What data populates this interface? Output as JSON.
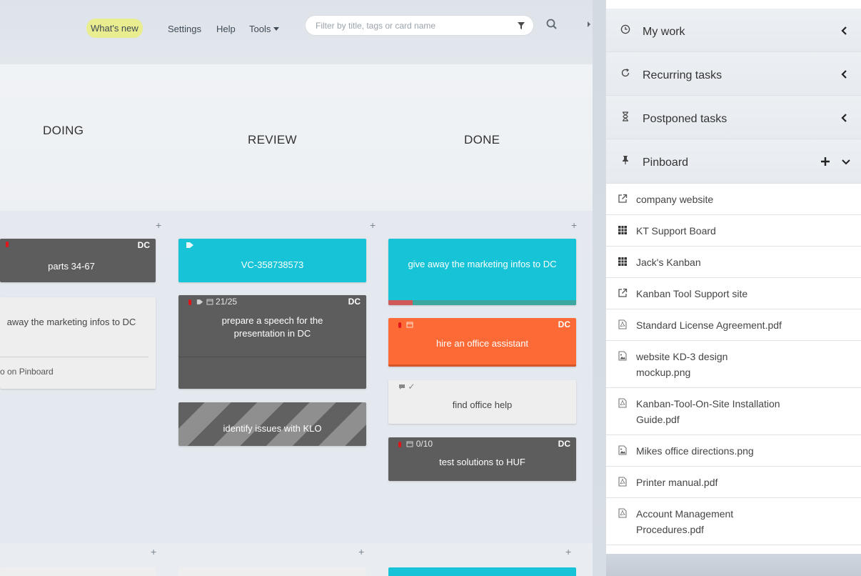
{
  "topbar": {
    "whats_new": "What's new",
    "settings": "Settings",
    "help": "Help",
    "tools": "Tools",
    "filter_placeholder": "Filter by title, tags or card name"
  },
  "columns": {
    "doing": "DOING",
    "review": "REVIEW",
    "done": "DONE"
  },
  "cards": {
    "doing_1": {
      "title": "parts 34-67",
      "owner": "DC"
    },
    "doing_2": {
      "title": "away the marketing infos to DC",
      "footer": "o on Pinboard"
    },
    "review_1": {
      "title": "VC-358738573"
    },
    "review_2": {
      "title": "prepare a speech for the presentation in DC",
      "progress": "21/25",
      "owner": "DC"
    },
    "review_3": {
      "title": "identify issues with KLO"
    },
    "done_1": {
      "title": "give away the marketing infos to DC"
    },
    "done_2": {
      "title": "hire an office assistant",
      "owner": "DC"
    },
    "done_3": {
      "title": "find office help"
    },
    "done_4": {
      "title": "test solutions to HUF",
      "progress": "0/10",
      "owner": "DC"
    }
  },
  "colors": {
    "cyan": "#17c3d6",
    "dark": "#5d5d5d",
    "orange": "#fe6a35",
    "light": "#eeeeee",
    "priority_red": "#e0161b",
    "whats_new_bg": "#e9ec8f"
  },
  "sidebar": {
    "my_work": "My work",
    "recurring": "Recurring tasks",
    "postponed": "Postponed tasks",
    "pinboard": "Pinboard",
    "pins": [
      {
        "icon": "external-link-icon",
        "label": "company website"
      },
      {
        "icon": "board-grid-icon",
        "label": "KT Support Board"
      },
      {
        "icon": "board-grid-icon",
        "label": "Jack's Kanban"
      },
      {
        "icon": "external-link-icon",
        "label": "Kanban Tool Support site"
      },
      {
        "icon": "pdf-file-icon",
        "label": "Standard License Agreement.pdf"
      },
      {
        "icon": "image-file-icon",
        "label": "website KD-3 design\nmockup.png"
      },
      {
        "icon": "pdf-file-icon",
        "label": "Kanban-Tool-On-Site Installation\nGuide.pdf"
      },
      {
        "icon": "image-file-icon",
        "label": "Mikes office directions.png"
      },
      {
        "icon": "pdf-file-icon",
        "label": "Printer manual.pdf"
      },
      {
        "icon": "pdf-file-icon",
        "label": "Account Management\nProcedures.pdf"
      }
    ]
  }
}
